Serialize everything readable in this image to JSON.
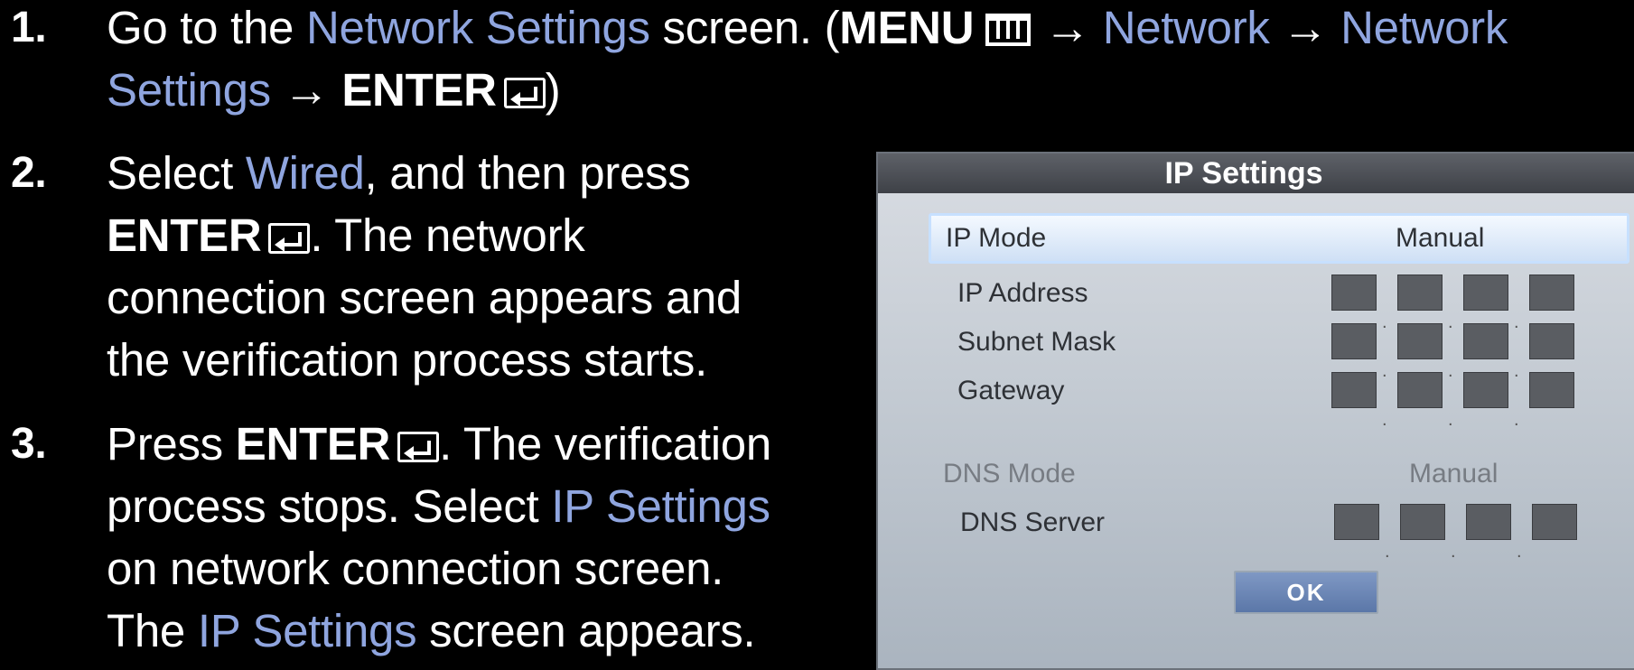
{
  "steps": [
    {
      "num": "1.",
      "lines": [
        [
          {
            "t": "Go to the "
          },
          {
            "t": "Network Settings",
            "c": "hl"
          },
          {
            "t": " screen. ("
          },
          {
            "t": "MENU",
            "c": "b"
          },
          {
            "icon": "menu"
          },
          {
            "t": " → "
          },
          {
            "t": "Network",
            "c": "hl"
          },
          {
            "t": " → "
          },
          {
            "t": "Network",
            "c": "hl"
          }
        ],
        [
          {
            "t": "Settings",
            "c": "hl"
          },
          {
            "t": " → "
          },
          {
            "t": "ENTER",
            "c": "b"
          },
          {
            "icon": "enter"
          },
          {
            "t": ")"
          }
        ]
      ]
    },
    {
      "num": "2.",
      "lines": [
        [
          {
            "t": "Select "
          },
          {
            "t": "Wired",
            "c": "hl"
          },
          {
            "t": ", and then press"
          }
        ],
        [
          {
            "t": "ENTER",
            "c": "b"
          },
          {
            "icon": "enter"
          },
          {
            "t": ". The network"
          }
        ],
        [
          {
            "t": "connection screen appears and"
          }
        ],
        [
          {
            "t": "the verification process starts."
          }
        ]
      ]
    },
    {
      "num": "3.",
      "lines": [
        [
          {
            "t": "Press "
          },
          {
            "t": "ENTER",
            "c": "b"
          },
          {
            "icon": "enter"
          },
          {
            "t": ". The verification"
          }
        ],
        [
          {
            "t": "process stops. Select "
          },
          {
            "t": "IP Settings",
            "c": "hl"
          }
        ],
        [
          {
            "t": "on network connection screen."
          }
        ],
        [
          {
            "t": "The "
          },
          {
            "t": "IP Settings",
            "c": "hl"
          },
          {
            "t": " screen appears."
          }
        ]
      ]
    }
  ],
  "dialog": {
    "title": "IP Settings",
    "ip_mode_label": "IP Mode",
    "ip_mode_value": "Manual",
    "ip_address_label": "IP Address",
    "subnet_mask_label": "Subnet Mask",
    "gateway_label": "Gateway",
    "dns_mode_label": "DNS Mode",
    "dns_mode_value": "Manual",
    "dns_server_label": "DNS Server",
    "ok_label": "OK"
  },
  "colors": {
    "highlight": "#8fa5df",
    "background": "#000000"
  }
}
